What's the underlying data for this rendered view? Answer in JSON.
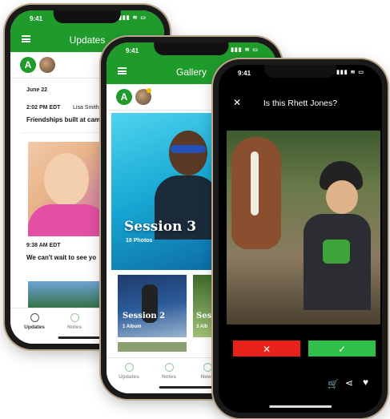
{
  "status": {
    "time": "9:41",
    "indicators": "▮▮▮ ≋ ▭"
  },
  "updates_screen": {
    "title": "Updates",
    "avatar_letter": "A",
    "date": "June 22",
    "post1": {
      "time": "2:02 PM EDT",
      "author": "Lisa Smith",
      "text": "Friendships built at cam"
    },
    "post2": {
      "time": "9:38 AM EDT",
      "text": "We can't wait to see yo"
    },
    "tabs": [
      "Updates",
      "Notes"
    ]
  },
  "gallery_screen": {
    "title": "Gallery",
    "avatar_letter": "A",
    "session3": {
      "name": "Session 3",
      "count": "18 Photos"
    },
    "session2": {
      "name": "Session 2",
      "count": "1 Album"
    },
    "session_partial": {
      "name": "Sess",
      "count": "3 Alb"
    },
    "tabs": [
      "Updates",
      "Notes",
      "News"
    ]
  },
  "face_screen": {
    "close": "✕",
    "question": "Is this Rhett Jones?",
    "reject": "✕",
    "confirm": "✓",
    "icons": [
      "cart-add-icon",
      "share-icon",
      "heart-icon"
    ]
  },
  "colors": {
    "brand_green": "#1f9b2c",
    "reject_red": "#e8221b",
    "confirm_green": "#2fbf4a"
  }
}
